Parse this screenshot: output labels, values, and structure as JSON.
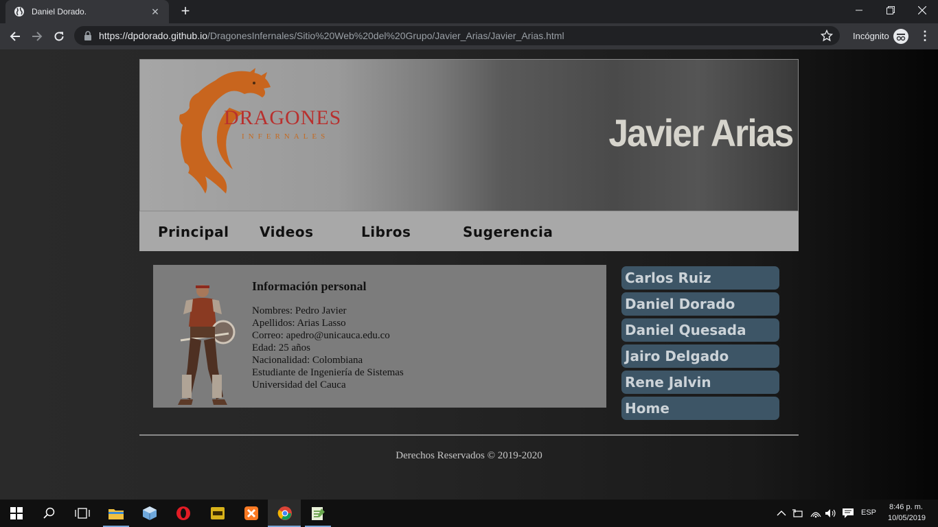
{
  "browser": {
    "tab_title": "Daniel Dorado.",
    "url_host": "https://dpdorado.github.io",
    "url_path": "/DragonesInfernales/Sitio%20Web%20del%20Grupo/Javier_Arias/Javier_Arias.html",
    "incognito_label": "Incógnito"
  },
  "site": {
    "logo_title": "DRAGONES",
    "logo_subtitle": "INFERNALES",
    "person_name": "Javier Arias",
    "nav": [
      "Principal",
      "Videos",
      "Libros",
      "Sugerencia"
    ],
    "info": {
      "title": "Información personal",
      "lines": [
        "Nombres: Pedro Javier",
        "Apellidos: Arias Lasso",
        "Correo: apedro@unicauca.edu.co",
        "Edad: 25 años",
        "Nacionalidad: Colombiana",
        "Estudiante de Ingeniería de Sistemas",
        "Universidad del Cauca"
      ]
    },
    "sidebar": [
      "Carlos Ruiz",
      "Daniel Dorado",
      "Daniel Quesada",
      "Jairo Delgado",
      "Rene Jalvin",
      "Home"
    ],
    "footer": "Derechos Reservados © 2019-2020"
  },
  "taskbar": {
    "language": "ESP",
    "time": "8:46 p. m.",
    "date": "10/05/2019"
  },
  "colors": {
    "accent_dragon": "#c8651e",
    "logo_red": "#b8302e",
    "sidebar_bg": "#3d5566"
  }
}
